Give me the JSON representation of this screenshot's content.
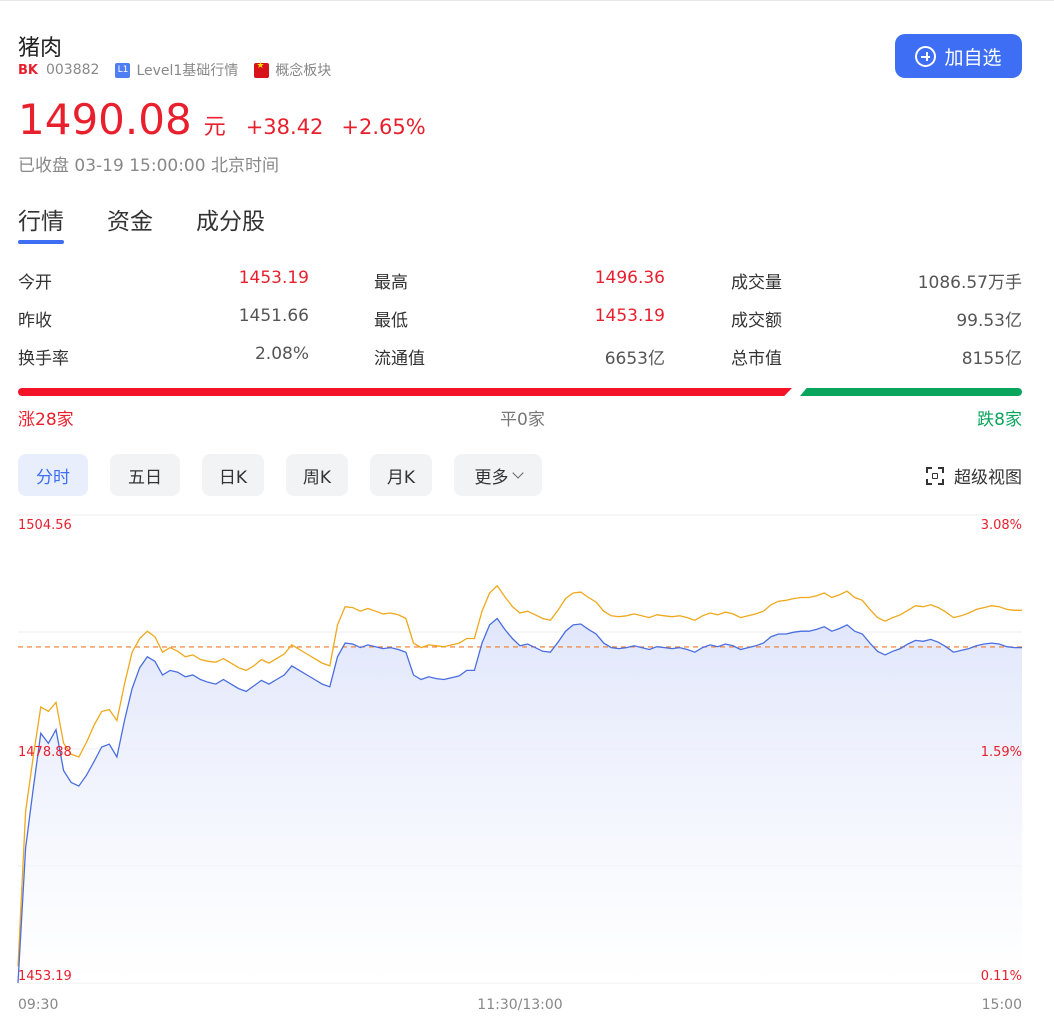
{
  "header": {
    "name": "猪肉",
    "bk_tag": "BK",
    "code": "003882",
    "level_tag": "L1",
    "level_text": "Level1基础行情",
    "sector_text": "概念板块",
    "add_button": "加自选"
  },
  "quote": {
    "price": "1490.08",
    "unit": "元",
    "change": "+38.42",
    "change_pct": "+2.65%",
    "status": "已收盘 03-19 15:00:00 北京时间"
  },
  "tabs": [
    "行情",
    "资金",
    "成分股"
  ],
  "stats": [
    [
      {
        "label": "今开",
        "value": "1453.19",
        "color": "red"
      },
      {
        "label": "最高",
        "value": "1496.36",
        "color": "red"
      },
      {
        "label": "成交量",
        "value": "1086.57万手",
        "color": "gray"
      }
    ],
    [
      {
        "label": "昨收",
        "value": "1451.66",
        "color": "gray"
      },
      {
        "label": "最低",
        "value": "1453.19",
        "color": "red"
      },
      {
        "label": "成交额",
        "value": "99.53亿",
        "color": "gray"
      }
    ],
    [
      {
        "label": "换手率",
        "value": "2.08%",
        "color": "gray"
      },
      {
        "label": "流通值",
        "value": "6653亿",
        "color": "gray"
      },
      {
        "label": "总市值",
        "value": "8155亿",
        "color": "gray"
      }
    ]
  ],
  "breadth": {
    "up": "涨28家",
    "flat": "平0家",
    "down": "跌8家",
    "up_count": 28,
    "flat_count": 0,
    "down_count": 8
  },
  "periods": [
    "分时",
    "五日",
    "日K",
    "周K",
    "月K",
    "更多"
  ],
  "super_view": "超级视图",
  "colors": {
    "up": "#e8202e",
    "down": "#0aa55c",
    "accent": "#3e6ef3",
    "price_line": "#4a6ee0",
    "avg_line": "#f0a81c",
    "ref_line": "#f07a2a"
  },
  "chart_data": {
    "type": "line",
    "title": "",
    "xlabel": "",
    "ylabel": "",
    "x_ticks": [
      "09:30",
      "11:30/13:00",
      "15:00"
    ],
    "y_ticks_left": [
      "1504.56",
      "1478.88",
      "1453.19"
    ],
    "y_ticks_right": [
      "3.08%",
      "1.59%",
      "0.11%"
    ],
    "ylim": [
      1453.19,
      1504.56
    ],
    "reference": 1490.08,
    "series": [
      {
        "values": [
          1453.2,
          1468.0,
          1474.5,
          1480.6,
          1479.5,
          1481.0,
          1476.5,
          1475.2,
          1474.8,
          1476.0,
          1477.5,
          1479.1,
          1479.4,
          1478.0,
          1482.0,
          1485.5,
          1487.8,
          1489.0,
          1488.5,
          1487.0,
          1487.5,
          1487.3,
          1486.8,
          1487.0,
          1486.5,
          1486.2,
          1486.0,
          1486.5,
          1486.0,
          1485.5,
          1485.2,
          1485.8,
          1486.4,
          1486.0,
          1486.5,
          1487.0,
          1488.0,
          1487.5,
          1487.0,
          1486.5,
          1486.0,
          1485.7,
          1489.0,
          1490.5,
          1490.4,
          1490.0,
          1490.3,
          1490.1,
          1489.9,
          1490.0,
          1489.8,
          1489.5,
          1487.0,
          1486.5,
          1486.8,
          1486.6,
          1486.5,
          1486.7,
          1486.9,
          1487.5,
          1487.5,
          1490.5,
          1492.5,
          1493.2,
          1492.0,
          1491.0,
          1490.2,
          1490.4,
          1490.0,
          1489.6,
          1489.5,
          1490.6,
          1491.8,
          1492.5,
          1492.6,
          1492.0,
          1491.5,
          1490.5,
          1490.0,
          1489.9,
          1490.0,
          1490.2,
          1490.0,
          1489.8,
          1490.1,
          1490.0,
          1489.9,
          1490.0,
          1489.8,
          1489.5,
          1490.0,
          1490.3,
          1490.1,
          1490.4,
          1490.2,
          1489.8,
          1490.0,
          1490.2,
          1490.5,
          1491.2,
          1491.5,
          1491.5,
          1491.7,
          1491.8,
          1491.8,
          1492.0,
          1492.3,
          1491.8,
          1492.1,
          1492.5,
          1491.8,
          1491.5,
          1490.5,
          1489.6,
          1489.2,
          1489.6,
          1489.9,
          1490.4,
          1490.8,
          1490.7,
          1490.9,
          1490.6,
          1490.1,
          1489.5,
          1489.7,
          1489.9,
          1490.2,
          1490.4,
          1490.5,
          1490.4,
          1490.1,
          1490.0,
          1490.0
        ]
      },
      {
        "values": [
          1455.0,
          1472.0,
          1478.0,
          1483.5,
          1483.0,
          1484.0,
          1479.5,
          1478.3,
          1478.0,
          1479.6,
          1481.5,
          1483.0,
          1483.2,
          1482.0,
          1486.0,
          1489.5,
          1491.0,
          1491.8,
          1491.2,
          1489.5,
          1490.0,
          1489.6,
          1489.0,
          1489.2,
          1488.7,
          1488.5,
          1488.4,
          1488.8,
          1488.3,
          1487.8,
          1487.5,
          1488.0,
          1488.7,
          1488.3,
          1488.8,
          1489.3,
          1490.3,
          1489.8,
          1489.3,
          1488.8,
          1488.3,
          1488.0,
          1492.5,
          1494.5,
          1494.4,
          1494.0,
          1494.3,
          1494.0,
          1493.7,
          1493.8,
          1493.6,
          1493.2,
          1490.5,
          1490.0,
          1490.3,
          1490.2,
          1490.1,
          1490.3,
          1490.5,
          1491.0,
          1491.0,
          1494.0,
          1496.0,
          1496.8,
          1495.6,
          1494.5,
          1493.8,
          1494.0,
          1493.6,
          1493.2,
          1493.0,
          1494.1,
          1495.4,
          1496.0,
          1496.1,
          1495.5,
          1495.0,
          1494.0,
          1493.5,
          1493.4,
          1493.5,
          1493.7,
          1493.5,
          1493.3,
          1493.6,
          1493.5,
          1493.4,
          1493.5,
          1493.3,
          1493.0,
          1493.5,
          1493.8,
          1493.6,
          1493.9,
          1493.7,
          1493.3,
          1493.5,
          1493.7,
          1494.0,
          1494.7,
          1495.1,
          1495.2,
          1495.4,
          1495.5,
          1495.5,
          1495.7,
          1496.0,
          1495.5,
          1495.8,
          1496.2,
          1495.5,
          1495.2,
          1494.2,
          1493.3,
          1492.9,
          1493.3,
          1493.6,
          1494.1,
          1494.6,
          1494.5,
          1494.7,
          1494.4,
          1493.9,
          1493.3,
          1493.5,
          1493.8,
          1494.2,
          1494.4,
          1494.6,
          1494.5,
          1494.2,
          1494.1,
          1494.1
        ]
      }
    ]
  }
}
